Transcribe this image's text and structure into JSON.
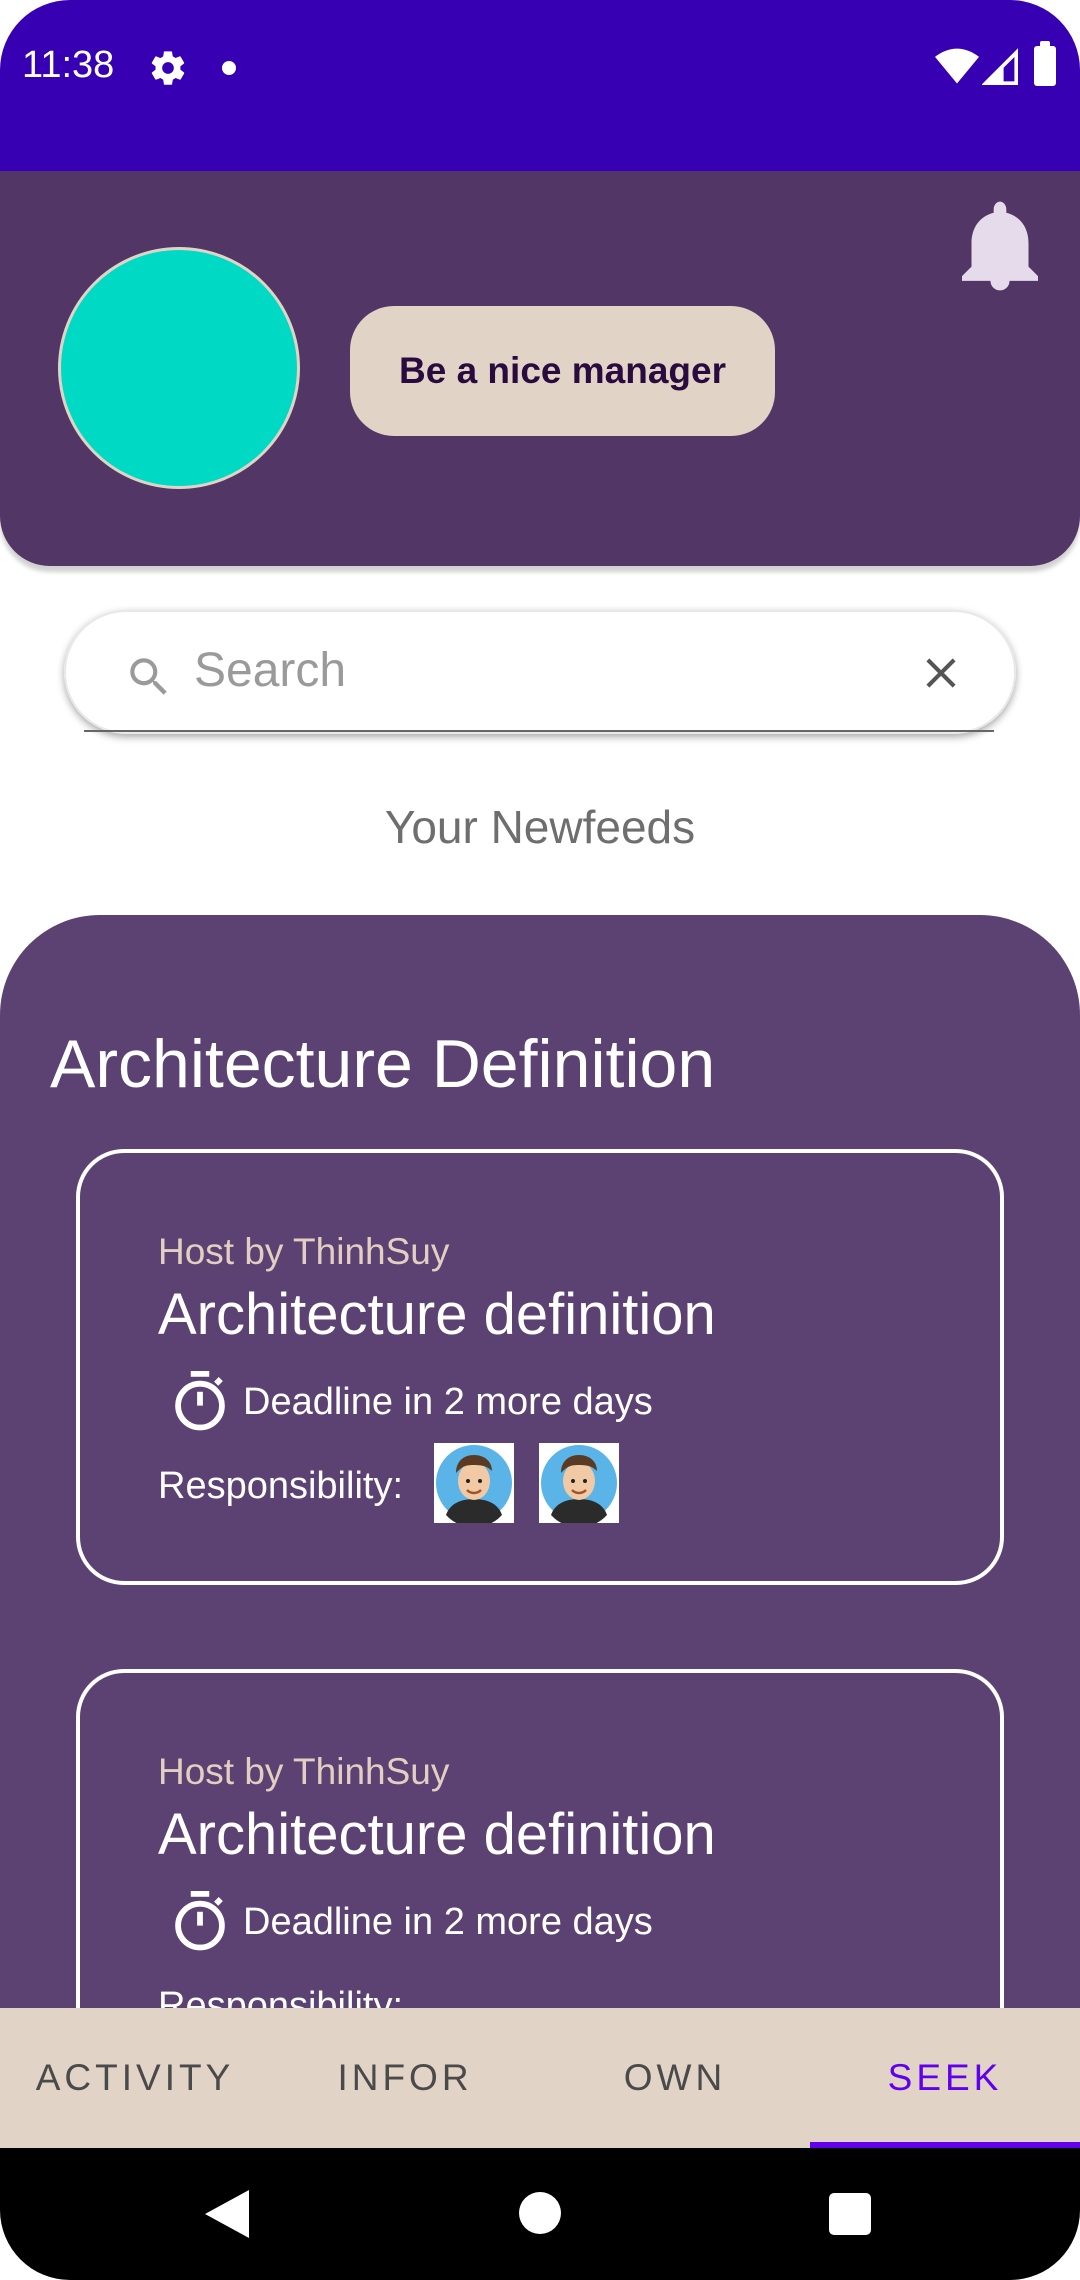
{
  "status_bar": {
    "time": "11:38",
    "icons": [
      "gear-icon",
      "notification-dot",
      "wifi-icon",
      "signal-icon",
      "battery-icon"
    ]
  },
  "header": {
    "avatar_color": "#00dac5",
    "motto": "Be a nice manager",
    "bell_icon": "bell-icon"
  },
  "search": {
    "placeholder": "Search",
    "value": ""
  },
  "feed": {
    "title": "Your Newfeeds",
    "section_title": "Architecture Definition",
    "cards": [
      {
        "host": "Host by ThinhSuy",
        "title": "Architecture definition",
        "deadline": "Deadline in 2 more days",
        "responsibility_label": "Responsibility:",
        "assignees": [
          "assignee-avatar",
          "assignee-avatar"
        ]
      },
      {
        "host": "Host by ThinhSuy",
        "title": "Architecture definition",
        "deadline": "Deadline in 2 more days",
        "responsibility_label": "Responsibility:",
        "assignees": []
      }
    ]
  },
  "tabs": [
    {
      "label": "ACTIVITY",
      "active": false
    },
    {
      "label": "INFOR",
      "active": false
    },
    {
      "label": "OWN",
      "active": false
    },
    {
      "label": "SEEK",
      "active": true
    }
  ],
  "colors": {
    "status_bar": "#3700b3",
    "header": "#523665",
    "panel": "#5c4272",
    "accent": "#6200ee",
    "pill": "#e1d3c5"
  }
}
